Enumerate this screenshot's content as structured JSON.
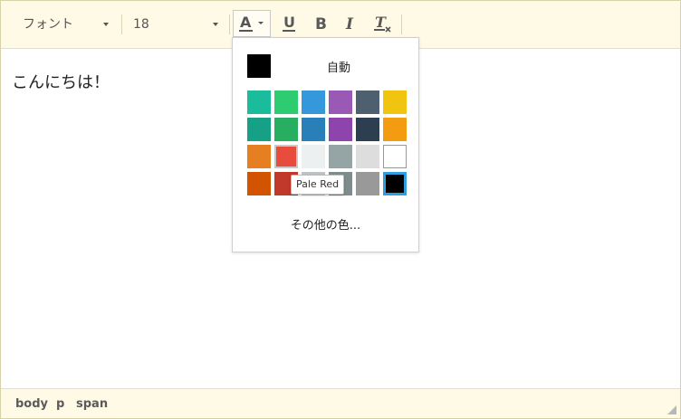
{
  "toolbar": {
    "font_select": {
      "value": "フォント"
    },
    "size_select": {
      "value": "18"
    },
    "buttons": [
      {
        "name": "text-color",
        "glyph": "A",
        "active": true
      },
      {
        "name": "underline",
        "glyph": "U"
      },
      {
        "name": "bold",
        "glyph": "B"
      },
      {
        "name": "italic",
        "glyph": "I"
      },
      {
        "name": "remove-format",
        "glyph": "Tx"
      }
    ]
  },
  "content": {
    "text": "こんにちは！"
  },
  "color_dropdown": {
    "auto": {
      "label": "自動",
      "color": "#000000"
    },
    "grid": [
      [
        "#1abc9c",
        "#2ecc71",
        "#3498db",
        "#9b59b6",
        "#4e5f70",
        "#f1c40f"
      ],
      [
        "#16a085",
        "#27ae60",
        "#2980b9",
        "#8e44ad",
        "#2c3e50",
        "#f39c12"
      ],
      [
        "#e67e22",
        "#e74c3c",
        "#ecf0f1",
        "#95a5a6",
        "#dddddd",
        "#ffffff"
      ],
      [
        "#d35400",
        "#c0392b",
        "#bdc3c7",
        "#7f8c8d",
        "#999999",
        "#000000"
      ]
    ],
    "hovered": {
      "row": 2,
      "col": 1
    },
    "selected": {
      "row": 3,
      "col": 5
    },
    "more_colors_label": "その他の色...",
    "tooltip": "Pale Red"
  },
  "statusbar": {
    "path": [
      "body",
      "p",
      "span"
    ]
  }
}
